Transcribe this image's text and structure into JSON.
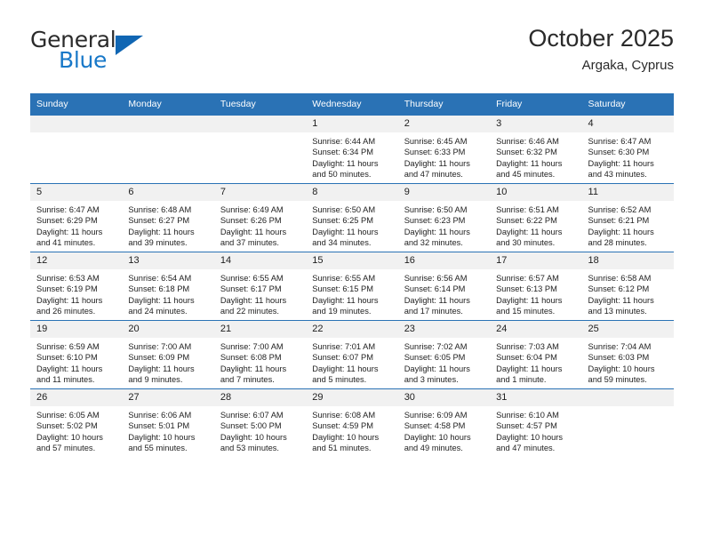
{
  "brand": {
    "name_part1": "General",
    "name_part2": "Blue",
    "accent_color": "#1878c8",
    "triangle_color": "#1066b3"
  },
  "header": {
    "title": "October 2025",
    "subtitle": "Argaka, Cyprus"
  },
  "theme": {
    "header_row_bg": "#2a72b5",
    "daynum_bg": "#f1f1f1",
    "row_divider": "#2a72b5"
  },
  "weekday_headers": [
    "Sunday",
    "Monday",
    "Tuesday",
    "Wednesday",
    "Thursday",
    "Friday",
    "Saturday"
  ],
  "labels": {
    "sunrise_prefix": "Sunrise:",
    "sunset_prefix": "Sunset:",
    "daylight_prefix": "Daylight:"
  },
  "weeks": [
    [
      {
        "day": "",
        "sunrise": "",
        "sunset": "",
        "daylight_l1": "",
        "daylight_l2": ""
      },
      {
        "day": "",
        "sunrise": "",
        "sunset": "",
        "daylight_l1": "",
        "daylight_l2": ""
      },
      {
        "day": "",
        "sunrise": "",
        "sunset": "",
        "daylight_l1": "",
        "daylight_l2": ""
      },
      {
        "day": "1",
        "sunrise": "Sunrise: 6:44 AM",
        "sunset": "Sunset: 6:34 PM",
        "daylight_l1": "Daylight: 11 hours",
        "daylight_l2": "and 50 minutes."
      },
      {
        "day": "2",
        "sunrise": "Sunrise: 6:45 AM",
        "sunset": "Sunset: 6:33 PM",
        "daylight_l1": "Daylight: 11 hours",
        "daylight_l2": "and 47 minutes."
      },
      {
        "day": "3",
        "sunrise": "Sunrise: 6:46 AM",
        "sunset": "Sunset: 6:32 PM",
        "daylight_l1": "Daylight: 11 hours",
        "daylight_l2": "and 45 minutes."
      },
      {
        "day": "4",
        "sunrise": "Sunrise: 6:47 AM",
        "sunset": "Sunset: 6:30 PM",
        "daylight_l1": "Daylight: 11 hours",
        "daylight_l2": "and 43 minutes."
      }
    ],
    [
      {
        "day": "5",
        "sunrise": "Sunrise: 6:47 AM",
        "sunset": "Sunset: 6:29 PM",
        "daylight_l1": "Daylight: 11 hours",
        "daylight_l2": "and 41 minutes."
      },
      {
        "day": "6",
        "sunrise": "Sunrise: 6:48 AM",
        "sunset": "Sunset: 6:27 PM",
        "daylight_l1": "Daylight: 11 hours",
        "daylight_l2": "and 39 minutes."
      },
      {
        "day": "7",
        "sunrise": "Sunrise: 6:49 AM",
        "sunset": "Sunset: 6:26 PM",
        "daylight_l1": "Daylight: 11 hours",
        "daylight_l2": "and 37 minutes."
      },
      {
        "day": "8",
        "sunrise": "Sunrise: 6:50 AM",
        "sunset": "Sunset: 6:25 PM",
        "daylight_l1": "Daylight: 11 hours",
        "daylight_l2": "and 34 minutes."
      },
      {
        "day": "9",
        "sunrise": "Sunrise: 6:50 AM",
        "sunset": "Sunset: 6:23 PM",
        "daylight_l1": "Daylight: 11 hours",
        "daylight_l2": "and 32 minutes."
      },
      {
        "day": "10",
        "sunrise": "Sunrise: 6:51 AM",
        "sunset": "Sunset: 6:22 PM",
        "daylight_l1": "Daylight: 11 hours",
        "daylight_l2": "and 30 minutes."
      },
      {
        "day": "11",
        "sunrise": "Sunrise: 6:52 AM",
        "sunset": "Sunset: 6:21 PM",
        "daylight_l1": "Daylight: 11 hours",
        "daylight_l2": "and 28 minutes."
      }
    ],
    [
      {
        "day": "12",
        "sunrise": "Sunrise: 6:53 AM",
        "sunset": "Sunset: 6:19 PM",
        "daylight_l1": "Daylight: 11 hours",
        "daylight_l2": "and 26 minutes."
      },
      {
        "day": "13",
        "sunrise": "Sunrise: 6:54 AM",
        "sunset": "Sunset: 6:18 PM",
        "daylight_l1": "Daylight: 11 hours",
        "daylight_l2": "and 24 minutes."
      },
      {
        "day": "14",
        "sunrise": "Sunrise: 6:55 AM",
        "sunset": "Sunset: 6:17 PM",
        "daylight_l1": "Daylight: 11 hours",
        "daylight_l2": "and 22 minutes."
      },
      {
        "day": "15",
        "sunrise": "Sunrise: 6:55 AM",
        "sunset": "Sunset: 6:15 PM",
        "daylight_l1": "Daylight: 11 hours",
        "daylight_l2": "and 19 minutes."
      },
      {
        "day": "16",
        "sunrise": "Sunrise: 6:56 AM",
        "sunset": "Sunset: 6:14 PM",
        "daylight_l1": "Daylight: 11 hours",
        "daylight_l2": "and 17 minutes."
      },
      {
        "day": "17",
        "sunrise": "Sunrise: 6:57 AM",
        "sunset": "Sunset: 6:13 PM",
        "daylight_l1": "Daylight: 11 hours",
        "daylight_l2": "and 15 minutes."
      },
      {
        "day": "18",
        "sunrise": "Sunrise: 6:58 AM",
        "sunset": "Sunset: 6:12 PM",
        "daylight_l1": "Daylight: 11 hours",
        "daylight_l2": "and 13 minutes."
      }
    ],
    [
      {
        "day": "19",
        "sunrise": "Sunrise: 6:59 AM",
        "sunset": "Sunset: 6:10 PM",
        "daylight_l1": "Daylight: 11 hours",
        "daylight_l2": "and 11 minutes."
      },
      {
        "day": "20",
        "sunrise": "Sunrise: 7:00 AM",
        "sunset": "Sunset: 6:09 PM",
        "daylight_l1": "Daylight: 11 hours",
        "daylight_l2": "and 9 minutes."
      },
      {
        "day": "21",
        "sunrise": "Sunrise: 7:00 AM",
        "sunset": "Sunset: 6:08 PM",
        "daylight_l1": "Daylight: 11 hours",
        "daylight_l2": "and 7 minutes."
      },
      {
        "day": "22",
        "sunrise": "Sunrise: 7:01 AM",
        "sunset": "Sunset: 6:07 PM",
        "daylight_l1": "Daylight: 11 hours",
        "daylight_l2": "and 5 minutes."
      },
      {
        "day": "23",
        "sunrise": "Sunrise: 7:02 AM",
        "sunset": "Sunset: 6:05 PM",
        "daylight_l1": "Daylight: 11 hours",
        "daylight_l2": "and 3 minutes."
      },
      {
        "day": "24",
        "sunrise": "Sunrise: 7:03 AM",
        "sunset": "Sunset: 6:04 PM",
        "daylight_l1": "Daylight: 11 hours",
        "daylight_l2": "and 1 minute."
      },
      {
        "day": "25",
        "sunrise": "Sunrise: 7:04 AM",
        "sunset": "Sunset: 6:03 PM",
        "daylight_l1": "Daylight: 10 hours",
        "daylight_l2": "and 59 minutes."
      }
    ],
    [
      {
        "day": "26",
        "sunrise": "Sunrise: 6:05 AM",
        "sunset": "Sunset: 5:02 PM",
        "daylight_l1": "Daylight: 10 hours",
        "daylight_l2": "and 57 minutes."
      },
      {
        "day": "27",
        "sunrise": "Sunrise: 6:06 AM",
        "sunset": "Sunset: 5:01 PM",
        "daylight_l1": "Daylight: 10 hours",
        "daylight_l2": "and 55 minutes."
      },
      {
        "day": "28",
        "sunrise": "Sunrise: 6:07 AM",
        "sunset": "Sunset: 5:00 PM",
        "daylight_l1": "Daylight: 10 hours",
        "daylight_l2": "and 53 minutes."
      },
      {
        "day": "29",
        "sunrise": "Sunrise: 6:08 AM",
        "sunset": "Sunset: 4:59 PM",
        "daylight_l1": "Daylight: 10 hours",
        "daylight_l2": "and 51 minutes."
      },
      {
        "day": "30",
        "sunrise": "Sunrise: 6:09 AM",
        "sunset": "Sunset: 4:58 PM",
        "daylight_l1": "Daylight: 10 hours",
        "daylight_l2": "and 49 minutes."
      },
      {
        "day": "31",
        "sunrise": "Sunrise: 6:10 AM",
        "sunset": "Sunset: 4:57 PM",
        "daylight_l1": "Daylight: 10 hours",
        "daylight_l2": "and 47 minutes."
      },
      {
        "day": "",
        "sunrise": "",
        "sunset": "",
        "daylight_l1": "",
        "daylight_l2": ""
      }
    ]
  ]
}
